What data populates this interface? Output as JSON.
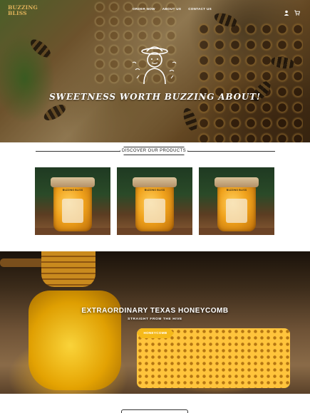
{
  "brand": {
    "logo_text": "BUZZING BLISS",
    "accent": "#e0b25a"
  },
  "nav": {
    "items": [
      "ORDER NOW",
      "ABOUT US",
      "CONTACT US"
    ]
  },
  "header_icons": [
    "user-icon",
    "cart-icon"
  ],
  "hero": {
    "tagline": "SWEETNESS WORTH BUZZING ABOUT!"
  },
  "products_section": {
    "heading": "DISCOVER OUR PRODUCTS",
    "products": [
      {
        "jar_label": "BUZZING BLISS"
      },
      {
        "jar_label": "BUZZING BLISS"
      },
      {
        "jar_label": "BUZZING BLISS"
      }
    ]
  },
  "banner": {
    "title": "EXTRAORDINARY TEXAS HONEYCOMB",
    "subtitle": "STRAIGHT FROM THE HIVE",
    "button_label": "HONEYCOMB",
    "button_color": "#f5b91a"
  }
}
